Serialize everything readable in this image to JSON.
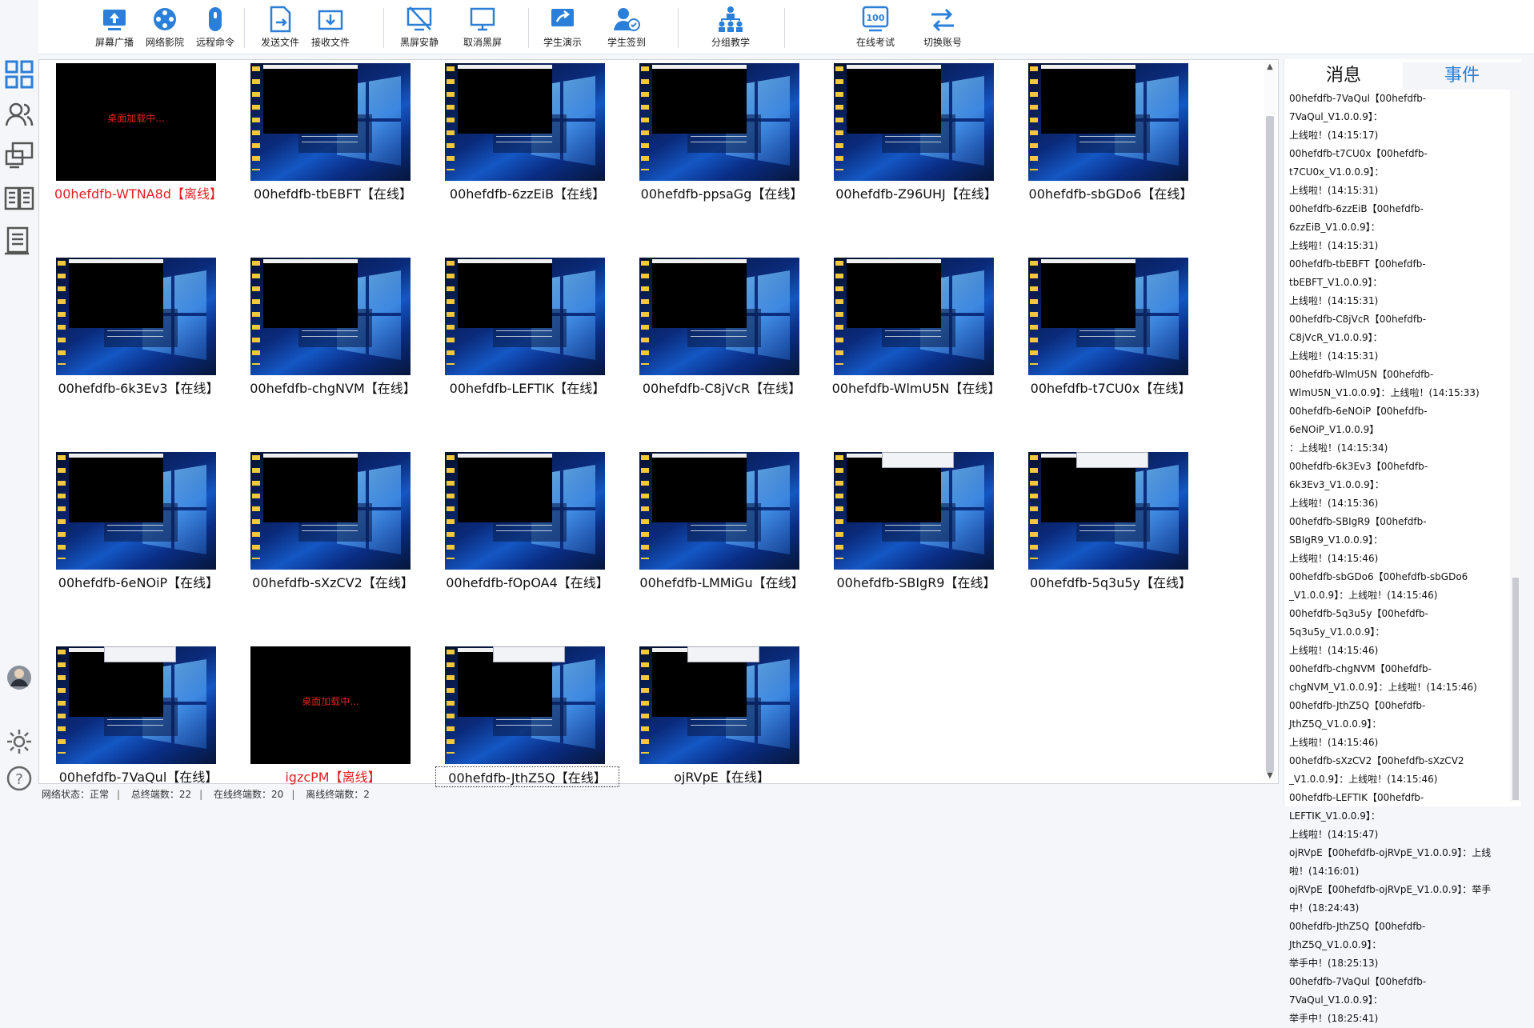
{
  "toolbar": {
    "buttons": [
      {
        "label": "屏幕广播",
        "icon": "broadcast-icon"
      },
      {
        "label": "网络影院",
        "icon": "cinema-icon"
      },
      {
        "label": "远程命令",
        "icon": "remote-command-icon"
      },
      {
        "label": "发送文件",
        "icon": "send-file-icon"
      },
      {
        "label": "接收文件",
        "icon": "receive-file-icon"
      },
      {
        "label": "黑屏安静",
        "icon": "black-screen-icon"
      },
      {
        "label": "取消黑屏",
        "icon": "cancel-black-screen-icon"
      },
      {
        "label": "学生演示",
        "icon": "student-demo-icon"
      },
      {
        "label": "学生签到",
        "icon": "student-signin-icon"
      },
      {
        "label": "分组教学",
        "icon": "group-teaching-icon"
      },
      {
        "label": "在线考试",
        "icon": "online-exam-icon"
      },
      {
        "label": "切换账号",
        "icon": "switch-account-icon"
      }
    ]
  },
  "clients": [
    {
      "name": "00hefdfb-WTNA8d",
      "status": "【离线】",
      "state": "offline",
      "loading": "桌面加载中..."
    },
    {
      "name": "00hefdfb-tbEBFT",
      "status": "【在线】",
      "state": "online"
    },
    {
      "name": "00hefdfb-6zzEiB",
      "status": "【在线】",
      "state": "online"
    },
    {
      "name": "00hefdfb-ppsaGg",
      "status": "【在线】",
      "state": "online"
    },
    {
      "name": "00hefdfb-Z96UHJ",
      "status": "【在线】",
      "state": "online"
    },
    {
      "name": "00hefdfb-sbGDo6",
      "status": "【在线】",
      "state": "online"
    },
    {
      "name": "00hefdfb-6k3Ev3",
      "status": "【在线】",
      "state": "online"
    },
    {
      "name": "00hefdfb-chgNVM",
      "status": "【在线】",
      "state": "online"
    },
    {
      "name": "00hefdfb-LEFTIK",
      "status": "【在线】",
      "state": "online"
    },
    {
      "name": "00hefdfb-C8jVcR",
      "status": "【在线】",
      "state": "online"
    },
    {
      "name": "00hefdfb-WlmU5N",
      "status": "【在线】",
      "state": "online"
    },
    {
      "name": "00hefdfb-t7CU0x",
      "status": "【在线】",
      "state": "online"
    },
    {
      "name": "00hefdfb-6eNOiP",
      "status": "【在线】",
      "state": "online"
    },
    {
      "name": "00hefdfb-sXzCV2",
      "status": "【在线】",
      "state": "online"
    },
    {
      "name": "00hefdfb-fOpOA4",
      "status": "【在线】",
      "state": "online"
    },
    {
      "name": "00hefdfb-LMMiGu",
      "status": "【在线】",
      "state": "online"
    },
    {
      "name": "00hefdfb-SBIgR9",
      "status": "【在线】",
      "state": "online"
    },
    {
      "name": "00hefdfb-5q3u5y",
      "status": "【在线】",
      "state": "online"
    },
    {
      "name": "00hefdfb-7VaQul",
      "status": "【在线】",
      "state": "online"
    },
    {
      "name": "igzcPM",
      "status": "【离线】",
      "state": "offline",
      "loading": "桌面加载中..."
    },
    {
      "name": "00hefdfb-JthZ5Q",
      "status": "【在线】",
      "state": "online",
      "selected": true
    },
    {
      "name": "ojRVpE",
      "status": "【在线】",
      "state": "online"
    }
  ],
  "side_panel": {
    "tab_messages": "消息",
    "tab_events": "事件",
    "events": [
      "00hefdfb-7VaQul【00hefdfb-7VaQul_V1.0.0.9】：",
      "上线啦！(14:15:17)",
      "00hefdfb-t7CU0x【00hefdfb-t7CU0x_V1.0.0.9】：",
      "上线啦！(14:15:31)",
      "00hefdfb-6zzEiB【00hefdfb-6zzEiB_V1.0.0.9】：",
      "上线啦！(14:15:31)",
      "00hefdfb-tbEBFT【00hefdfb-tbEBFT_V1.0.0.9】：",
      "上线啦！(14:15:31)",
      "00hefdfb-C8jVcR【00hefdfb-C8jVcR_V1.0.0.9】：",
      "上线啦！(14:15:31)",
      "00hefdfb-WlmU5N【00hefdfb-",
      "WlmU5N_V1.0.0.9】：上线啦！(14:15:33)",
      "00hefdfb-6eNOiP【00hefdfb-6eNOiP_V1.0.0.9】",
      "：上线啦！(14:15:34)",
      "00hefdfb-6k3Ev3【00hefdfb-6k3Ev3_V1.0.0.9】：",
      "上线啦！(14:15:36)",
      "00hefdfb-SBIgR9【00hefdfb-SBIgR9_V1.0.0.9】：",
      "上线啦！(14:15:46)",
      "00hefdfb-sbGDo6【00hefdfb-sbGDo6",
      "_V1.0.0.9】：上线啦！(14:15:46)",
      "00hefdfb-5q3u5y【00hefdfb-5q3u5y_V1.0.0.9】：",
      "上线啦！(14:15:46)",
      "00hefdfb-chgNVM【00hefdfb-",
      "chgNVM_V1.0.0.9】：上线啦！(14:15:46)",
      "00hefdfb-JthZ5Q【00hefdfb-JthZ5Q_V1.0.0.9】：",
      "上线啦！(14:15:46)",
      "00hefdfb-sXzCV2【00hefdfb-sXzCV2",
      "_V1.0.0.9】：上线啦！(14:15:46)",
      "00hefdfb-LEFTIK【00hefdfb-LEFTIK_V1.0.0.9】：",
      "上线啦！(14:15:47)",
      "ojRVpE【00hefdfb-ojRVpE_V1.0.0.9】：上线",
      "啦！(14:16:01)",
      "ojRVpE【00hefdfb-ojRVpE_V1.0.0.9】：举手",
      "中！(18:24:43)",
      "00hefdfb-JthZ5Q【00hefdfb-JthZ5Q_V1.0.0.9】：",
      "举手中！(18:25:13)",
      "00hefdfb-7VaQul【00hefdfb-7VaQul_V1.0.0.9】：",
      "举手中！(18:25:41)"
    ]
  },
  "status_bar": {
    "network": "网络状态：正常",
    "total": "总终端数：22",
    "online": "在线终端数：20",
    "offline": "离线终端数：2"
  },
  "colors": {
    "accent": "#2b7fd8",
    "offline": "#e02020"
  }
}
